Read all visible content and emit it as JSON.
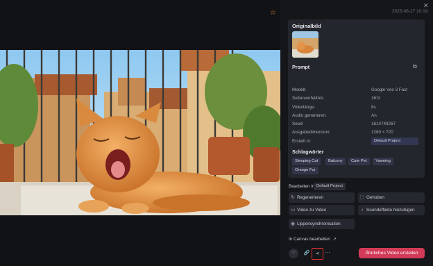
{
  "timestamp": "2025-08-17 10:19",
  "panel": {
    "original_title": "Originalbild",
    "prompt_label": "Prompt",
    "meta": [
      {
        "label": "Modell:",
        "value": "Google Veo 3 Fast"
      },
      {
        "label": "Seitenverhältnis:",
        "value": "16:9"
      },
      {
        "label": "Videolänge:",
        "value": "8s"
      },
      {
        "label": "Audio generieren:",
        "value": "An"
      },
      {
        "label": "Seed:",
        "value": "1614749267"
      },
      {
        "label": "Ausgabedimension:",
        "value": "1280 × 720"
      },
      {
        "label": "Erstellt in:",
        "value": "Default Project"
      }
    ],
    "tags_title": "Schlagwörter",
    "tags": [
      "Sleeping Cat",
      "Balcony",
      "Cute Pet",
      "Yawning",
      "Orange Fur"
    ]
  },
  "edit": {
    "label": "Bearbeiten in",
    "project": "Default Project",
    "buttons": [
      {
        "label": "Regenerieren",
        "icon": "refresh-icon"
      },
      {
        "label": "Gehoben",
        "icon": "upscale-icon"
      },
      {
        "label": "Video zu Video",
        "icon": "video-icon"
      },
      {
        "label": "Soundeffekte hinzufügen",
        "icon": "music-icon"
      },
      {
        "label": "Lippensynchronisation",
        "icon": "lips-icon"
      }
    ],
    "canvas_link": "In Canvas bearbeiten"
  },
  "footer": {
    "cta": "Ähnliches Video erstellen",
    "more": "···"
  },
  "colors": {
    "accent": "#d33a58",
    "star": "#e8862d",
    "highlight": "#e03030"
  }
}
